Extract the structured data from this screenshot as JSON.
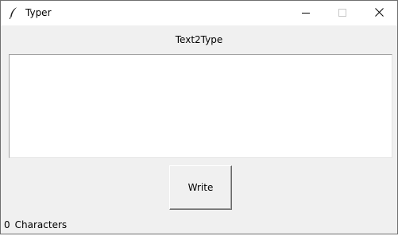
{
  "window": {
    "title": "Typer",
    "app_icon": "feather-icon",
    "controls": {
      "minimize_icon": "minimize-icon",
      "maximize_icon": "maximize-icon",
      "close_icon": "close-icon"
    }
  },
  "main": {
    "heading": "Text2Type",
    "text_input": {
      "value": ""
    },
    "write_button": {
      "label": "Write"
    }
  },
  "status": {
    "count": "0",
    "label": "Characters"
  }
}
